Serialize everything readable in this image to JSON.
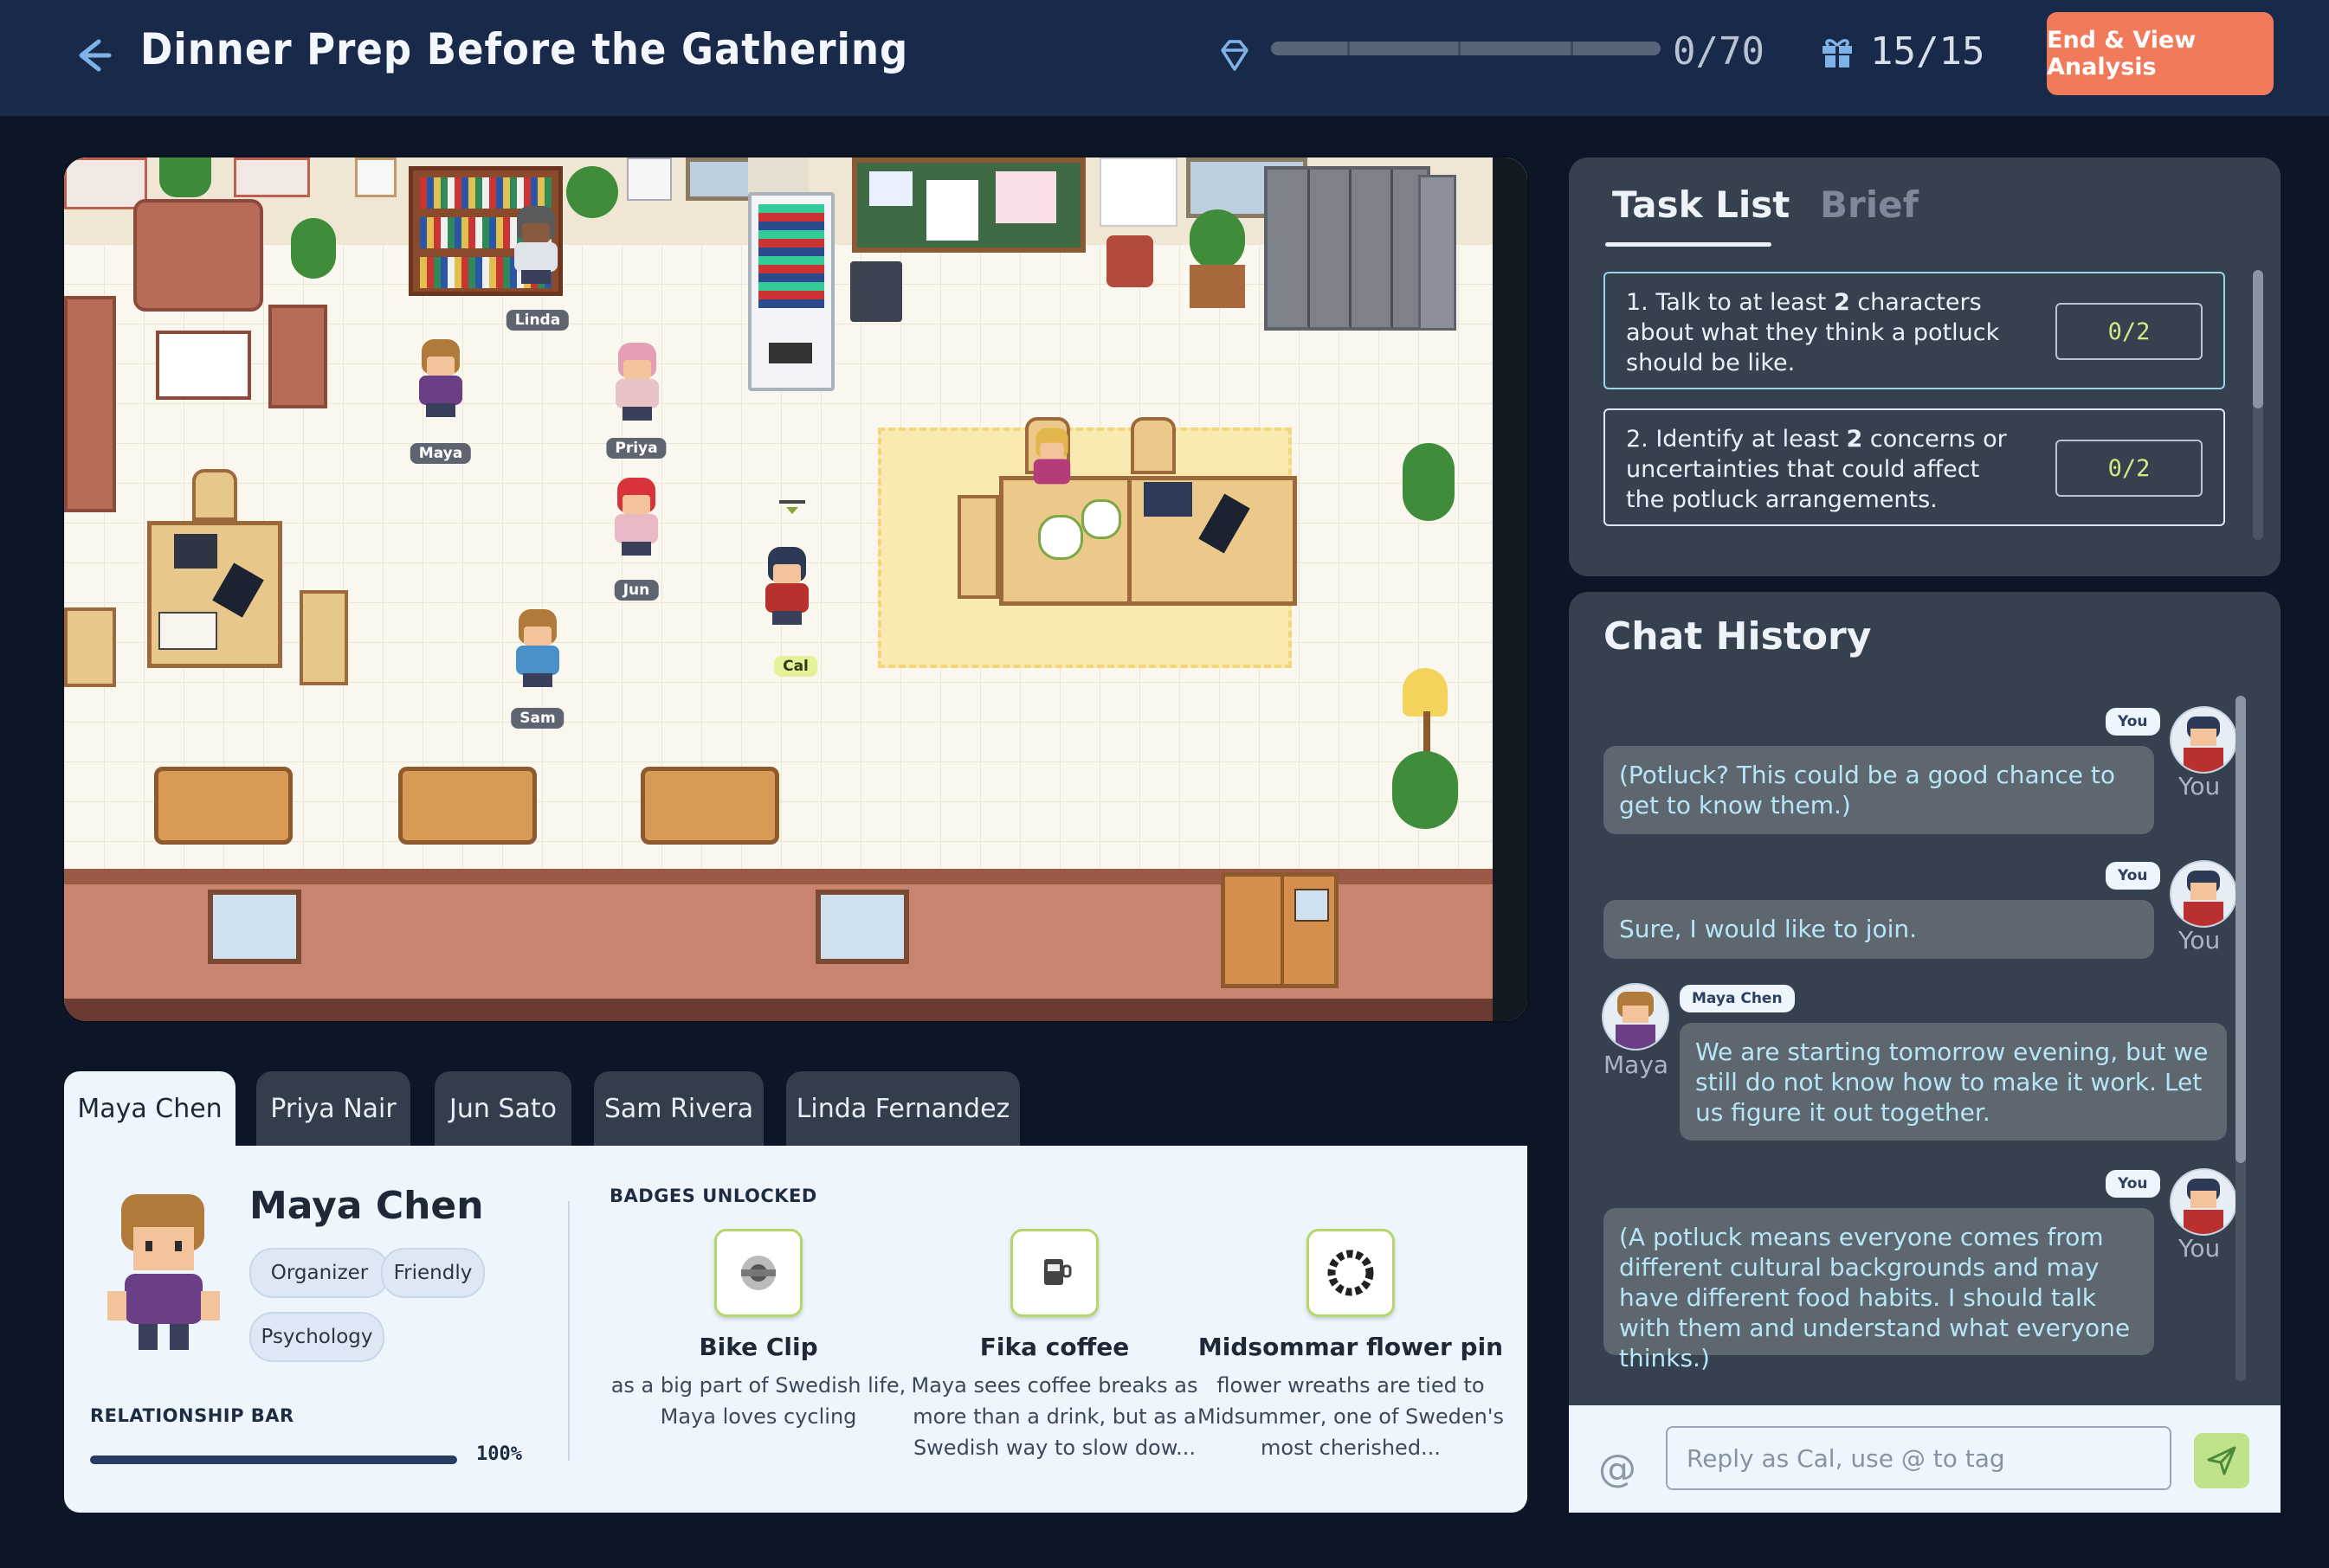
{
  "header": {
    "title": "Dinner Prep Before the Gathering",
    "score": "0/70",
    "score_progress": 0,
    "gifts": "15/15",
    "end_button": "End & View Analysis"
  },
  "map": {
    "characters": [
      "Linda",
      "Maya",
      "Priya",
      "Jun",
      "Sam",
      "Cal"
    ],
    "player": "Cal"
  },
  "character_tabs": [
    "Maya Chen",
    "Priya Nair",
    "Jun Sato",
    "Sam Rivera",
    "Linda Fernandez"
  ],
  "profile": {
    "name": "Maya Chen",
    "traits": [
      "Organizer",
      "Friendly",
      "Psychology"
    ],
    "relationship_title": "RELATIONSHIP BAR",
    "relationship_value": 1.0,
    "relationship_pct": "100%",
    "badges_title": "BADGES UNLOCKED",
    "badges": [
      {
        "name": "Bike Clip",
        "desc": "as a big part of Swedish life, Maya loves cycling"
      },
      {
        "name": "Fika coffee",
        "desc": "Maya sees coffee breaks as more than a drink, but as a Swedish way to slow dow..."
      },
      {
        "name": "Midsommar flower pin",
        "desc": "flower wreaths are tied to Midsummer, one of Sweden's most cherished..."
      }
    ]
  },
  "tasks": {
    "tabs": [
      "Task List",
      "Brief"
    ],
    "items": [
      {
        "pre": "1. Talk to at least ",
        "bold": "2",
        "post": " characters about what they think a potluck should be like.",
        "count": "0/2"
      },
      {
        "pre": "2. Identify at least ",
        "bold": "2",
        "post": " concerns or uncertainties that could affect the potluck arrangements.",
        "count": "0/2"
      }
    ]
  },
  "chat": {
    "title": "Chat History",
    "you_label": "You",
    "messages": [
      {
        "speaker": "You",
        "tag": "You",
        "text": "(Potluck? This could be a good chance to get to know them.)"
      },
      {
        "speaker": "You",
        "tag": "You",
        "text": "Sure, I would like to join."
      },
      {
        "speaker": "Maya",
        "tag": "Maya Chen",
        "text": "We are starting tomorrow evening, but we still do not know how to make it work. Let us figure it out together."
      },
      {
        "speaker": "You",
        "tag": "You",
        "text": "(A potluck means everyone comes from different cultural backgrounds and may have different food habits. I should talk with them and understand what everyone thinks.)"
      }
    ],
    "input_at": "@",
    "input_placeholder": "Reply as Cal, use @ to tag"
  },
  "colors": {
    "accent": "#f07a5a",
    "progress": "#9fe05c",
    "bubble_text": "#b6e6f5"
  }
}
